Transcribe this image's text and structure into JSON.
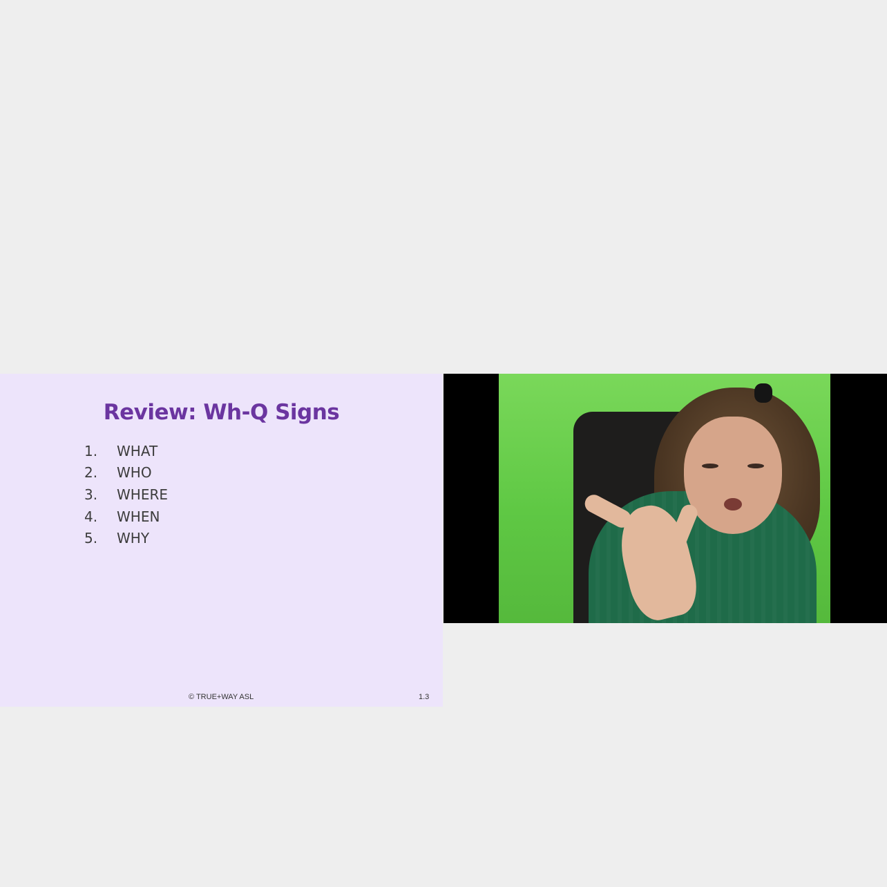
{
  "slide": {
    "title": "Review: Wh-Q Signs",
    "items": [
      {
        "num": "1.",
        "label": "WHAT"
      },
      {
        "num": "2.",
        "label": "WHO"
      },
      {
        "num": "3.",
        "label": "WHERE"
      },
      {
        "num": "4.",
        "label": "WHEN"
      },
      {
        "num": "5.",
        "label": "WHY"
      }
    ],
    "copyright": "© TRUE+WAY ASL",
    "page_number": "1.3"
  },
  "colors": {
    "page_background": "#eeeeee",
    "slide_background": "#ede4fb",
    "title_color": "#6b35a0",
    "video_letterbox": "#000000",
    "green_screen": "#5fc844"
  },
  "video": {
    "subject": "signer on green screen"
  }
}
